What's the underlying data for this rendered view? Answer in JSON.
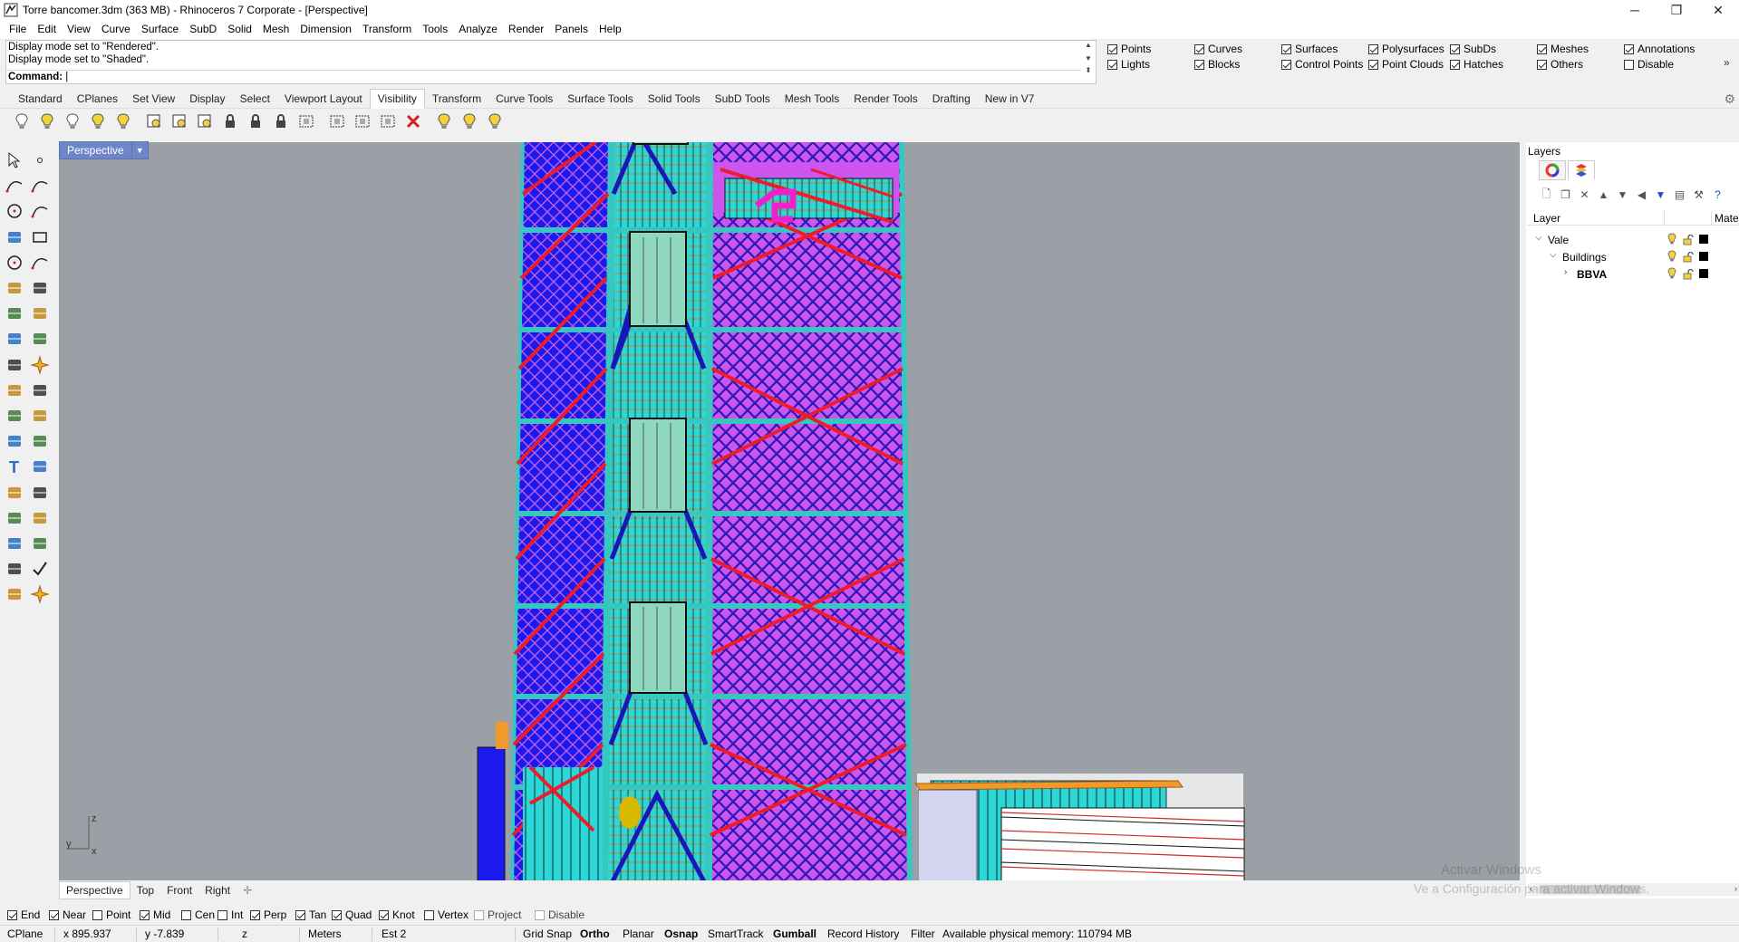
{
  "window": {
    "title": "Torre bancomer.3dm (363 MB) - Rhinoceros 7 Corporate - [Perspective]",
    "minimize": "─",
    "restore": "❐",
    "close": "✕"
  },
  "menu": [
    "File",
    "Edit",
    "View",
    "Curve",
    "Surface",
    "SubD",
    "Solid",
    "Mesh",
    "Dimension",
    "Transform",
    "Tools",
    "Analyze",
    "Render",
    "Panels",
    "Help"
  ],
  "command_history": {
    "line1": "Display mode set to \"Rendered\".",
    "line2": "Display mode set to \"Shaded\".",
    "prompt": "Command:",
    "value": ""
  },
  "visibility": [
    {
      "label": "Points",
      "checked": true
    },
    {
      "label": "Lights",
      "checked": true
    },
    {
      "label": "Curves",
      "checked": true
    },
    {
      "label": "Blocks",
      "checked": true
    },
    {
      "label": "Surfaces",
      "checked": true
    },
    {
      "label": "Control Points",
      "checked": true
    },
    {
      "label": "Polysurfaces",
      "checked": true
    },
    {
      "label": "Point Clouds",
      "checked": true
    },
    {
      "label": "SubDs",
      "checked": true
    },
    {
      "label": "Hatches",
      "checked": true
    },
    {
      "label": "Meshes",
      "checked": true
    },
    {
      "label": "Others",
      "checked": true
    },
    {
      "label": "Annotations",
      "checked": true
    },
    {
      "label": "Disable",
      "checked": false
    }
  ],
  "toolbar_tabs": [
    {
      "label": "Standard",
      "active": false
    },
    {
      "label": "CPlanes",
      "active": false
    },
    {
      "label": "Set View",
      "active": false
    },
    {
      "label": "Display",
      "active": false
    },
    {
      "label": "Select",
      "active": false
    },
    {
      "label": "Viewport Layout",
      "active": false
    },
    {
      "label": "Visibility",
      "active": true
    },
    {
      "label": "Transform",
      "active": false
    },
    {
      "label": "Curve Tools",
      "active": false
    },
    {
      "label": "Surface Tools",
      "active": false
    },
    {
      "label": "Solid Tools",
      "active": false
    },
    {
      "label": "SubD Tools",
      "active": false
    },
    {
      "label": "Mesh Tools",
      "active": false
    },
    {
      "label": "Render Tools",
      "active": false
    },
    {
      "label": "Drafting",
      "active": false
    },
    {
      "label": "New in V7",
      "active": false
    }
  ],
  "toolbar_icons": [
    "light-bulb-icon",
    "light-bulb-on-icon",
    "light-bulb-icon",
    "light-bulb-select-icon",
    "light-bulb-multi-icon",
    "show-objects-icon",
    "show-selected-icon",
    "show-layers-icon",
    "lock-icon",
    "unlock-icon",
    "lock-selected-icon",
    "swap-hidden-icon",
    "bounding-box-icon",
    "bounding-box-alt-icon",
    "isolate-icon",
    "hide-red-icon",
    "light-bulb-group-icon",
    "light-bulb-group-icon",
    "light-bulb-group-icon"
  ],
  "left_tools": [
    "select-arrow-icon",
    "point-icon",
    "polyline-icon",
    "curve-icon",
    "circle-icon",
    "arc-icon",
    "triangle-icon",
    "rectangle-icon",
    "ellipse-icon",
    "freeform-curve-icon",
    "surface-icon",
    "surface-patch-icon",
    "box-solid-icon",
    "boolean-icon",
    "extrude-icon",
    "extrude-alt-icon",
    "explode-icon",
    "spark-icon",
    "dimension-icon",
    "hatch-icon",
    "group-icon",
    "transform-icon",
    "fillet-icon",
    "offset-icon",
    "text-icon",
    "scale-icon",
    "array-icon",
    "distribute-icon",
    "block-icon",
    "mirror-icon",
    "grid-array-icon",
    "gumball-icon",
    "analyze-icon",
    "check-icon",
    "render-icon",
    "light-icon"
  ],
  "viewport": {
    "name": "Perspective",
    "dropdown": "▼",
    "axis_z": "z",
    "axis_y": "y",
    "axis_x": "x"
  },
  "viewport_tabs": [
    {
      "label": "Perspective",
      "active": true
    },
    {
      "label": "Top",
      "active": false
    },
    {
      "label": "Front",
      "active": false
    },
    {
      "label": "Right",
      "active": false
    }
  ],
  "viewport_tab_add": "✛",
  "layers_panel": {
    "title": "Layers",
    "col_layer": "Layer",
    "col_material": "Mate",
    "rows": [
      {
        "name": "Vale",
        "level": 0,
        "expanded": true,
        "bold": false,
        "twisty": "⌵"
      },
      {
        "name": "Buildings",
        "level": 1,
        "expanded": true,
        "bold": false,
        "twisty": "⌵"
      },
      {
        "name": "BBVA",
        "level": 2,
        "expanded": false,
        "bold": true,
        "twisty": "›"
      }
    ]
  },
  "watermark": {
    "line1": "Activar Windows",
    "line2": "Ve a Configuración para activar Windows."
  },
  "osnaps": [
    {
      "label": "End",
      "checked": true
    },
    {
      "label": "Near",
      "checked": true
    },
    {
      "label": "Point",
      "checked": false
    },
    {
      "label": "Mid",
      "checked": true
    },
    {
      "label": "Cen",
      "checked": false
    },
    {
      "label": "Int",
      "checked": false
    },
    {
      "label": "Perp",
      "checked": true
    },
    {
      "label": "Tan",
      "checked": true
    },
    {
      "label": "Quad",
      "checked": true
    },
    {
      "label": "Knot",
      "checked": true
    },
    {
      "label": "Vertex",
      "checked": false
    },
    {
      "label": "Project",
      "checked": false,
      "disabled": true
    },
    {
      "label": "Disable",
      "checked": false,
      "disabled": true
    }
  ],
  "status": {
    "cplane": "CPlane",
    "x": "x 895.937",
    "y": "y -7.839",
    "z": "z",
    "units": "Meters",
    "layer": "Est 2",
    "grid_snap": "Grid Snap",
    "ortho": "Ortho",
    "planar": "Planar",
    "osnap": "Osnap",
    "smarttrack": "SmartTrack",
    "gumball": "Gumball",
    "record_history": "Record History",
    "filter": "Filter",
    "memory": "Available physical memory: 110794 MB"
  }
}
